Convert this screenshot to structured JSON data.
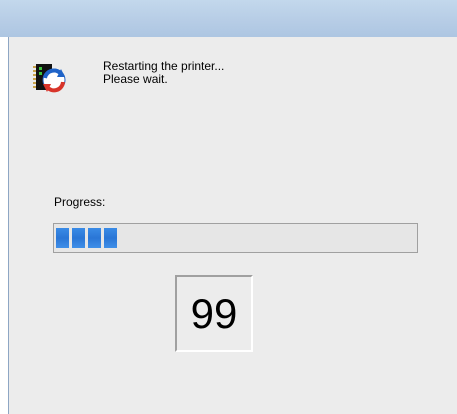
{
  "message": {
    "line1": "Restarting the printer...",
    "line2": "Please wait."
  },
  "progress": {
    "label": "Progress:",
    "segments_filled": 4,
    "fraction": 0.22
  },
  "counter": {
    "value": "99"
  },
  "icons": {
    "app": "printer-restart-icon"
  },
  "colors": {
    "progress_fill": "#2a76d6",
    "titlebar": "#b7cde6",
    "background": "#ececec"
  }
}
